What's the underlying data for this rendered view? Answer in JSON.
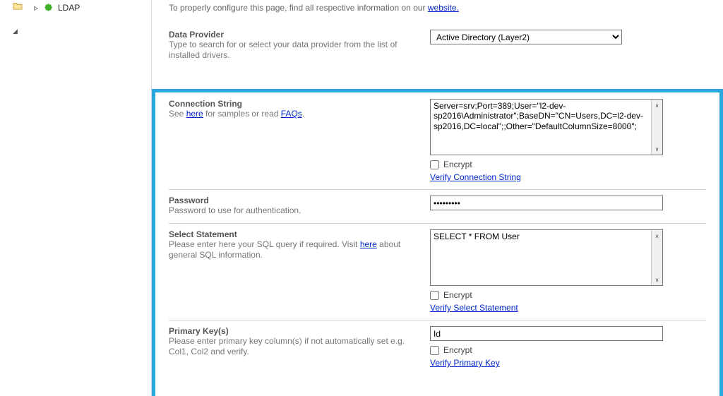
{
  "sidebar": {
    "ldap_item": "LDAP",
    "tree_arrow": "▲"
  },
  "intro": {
    "text_prefix": "To properly configure this page, find all respective information on our ",
    "link": "website."
  },
  "dataProvider": {
    "title": "Data Provider",
    "help": "Type to search for or select your data provider from the list of installed drivers.",
    "value": "Active Directory (Layer2)"
  },
  "connString": {
    "title": "Connection String",
    "help_pre": "See ",
    "help_link1": "here",
    "help_mid": " for samples or read ",
    "help_link2": "FAQs",
    "help_post": ".",
    "value": "Server=srv;Port=389;User=\"l2-dev-sp2016\\Administrator\";BaseDN=\"CN=Users,DC=l2-dev-sp2016,DC=local\";;Other=\"DefaultColumnSize=8000\";",
    "encrypt_label": "Encrypt",
    "verify_link": "Verify Connection String"
  },
  "password": {
    "title": "Password",
    "help": "Password to use for authentication.",
    "value": "•••••••••"
  },
  "selectStmt": {
    "title": "Select Statement",
    "help_pre": "Please enter here your SQL query if required. Visit ",
    "help_link": "here",
    "help_post": " about general SQL information.",
    "value": "SELECT * FROM User",
    "encrypt_label": "Encrypt",
    "verify_link": "Verify Select Statement"
  },
  "primaryKey": {
    "title": "Primary Key(s)",
    "help": "Please enter primary key column(s) if not automatically set e.g. Col1, Col2 and verify.",
    "value": "Id",
    "encrypt_label": "Encrypt",
    "verify_link": "Verify Primary Key"
  }
}
